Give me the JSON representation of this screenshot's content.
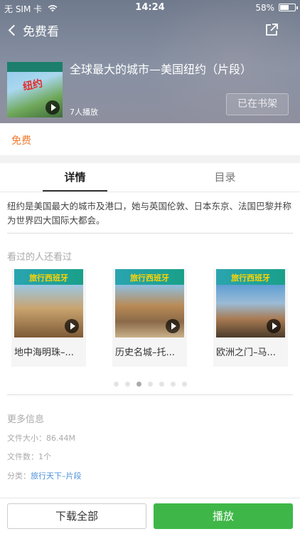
{
  "status_bar": {
    "carrier": "无 SIM 卡",
    "time": "14:24",
    "battery": "58%",
    "battery_level": 0.58
  },
  "nav": {
    "back_label": "免费看"
  },
  "album": {
    "cover_text": "纽约",
    "title": "全球最大的城市—美国纽约（片段）",
    "plays": "7人播放",
    "shelf_button": "已在书架"
  },
  "price": "免费",
  "tabs": [
    {
      "label": "详情"
    },
    {
      "label": "目录"
    }
  ],
  "description": "纽约是美国最大的城市及港口，她与英国伦敦、日本东京、法国巴黎并称为世界四大国际大都会。",
  "recommend": {
    "heading": "看过的人还看过",
    "items": [
      {
        "banner": "旅行西班牙",
        "name": "地中海明珠–..."
      },
      {
        "banner": "旅行西班牙",
        "name": "历史名城–托..."
      },
      {
        "banner": "旅行西班牙",
        "name": "欧洲之门–马..."
      }
    ],
    "page_count": 7,
    "active_page": 3
  },
  "more_info": {
    "heading": "更多信息",
    "file_size": "文件大小：86.44M",
    "file_count": "文件数：1个",
    "category_label": "分类：",
    "category_value": "旅行天下–片段"
  },
  "actions": {
    "download": "下载全部",
    "play": "播放"
  },
  "colors": {
    "accent_green": "#3fb748",
    "price_orange": "#f07b2f",
    "link_blue": "#4a90d9"
  }
}
